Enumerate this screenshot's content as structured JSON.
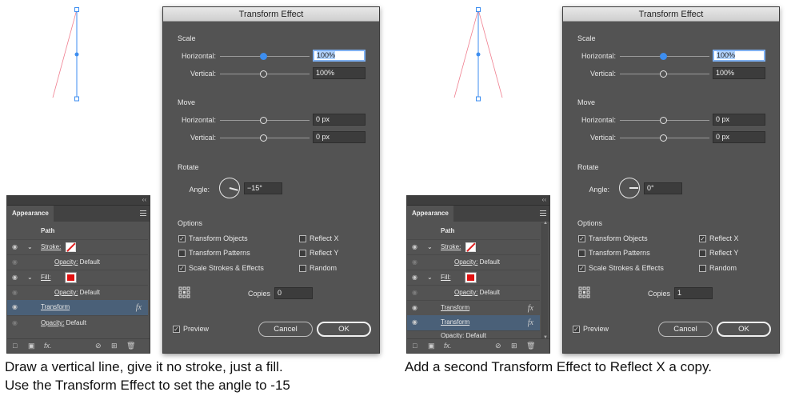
{
  "colors": {
    "accent": "#3d8ef0",
    "dialog_bg": "#535353",
    "fill_swatch": "#e01010",
    "selected_row": "#4a6078",
    "guide_line": "#f08090"
  },
  "steps": [
    {
      "dialog": {
        "title": "Transform Effect",
        "scale": {
          "label": "Scale",
          "h_label": "Horizontal:",
          "h_value": "100%",
          "v_label": "Vertical:",
          "v_value": "100%"
        },
        "move": {
          "label": "Move",
          "h_label": "Horizontal:",
          "h_value": "0 px",
          "v_label": "Vertical:",
          "v_value": "0 px"
        },
        "rotate": {
          "label": "Rotate",
          "angle_label": "Angle:",
          "angle_value": "−15°"
        },
        "options": {
          "label": "Options",
          "transform_objects": "Transform Objects",
          "transform_patterns": "Transform Patterns",
          "scale_strokes": "Scale Strokes & Effects",
          "reflect_x": "Reflect X",
          "reflect_y": "Reflect Y",
          "random": "Random",
          "copies_label": "Copies",
          "copies_value": "0"
        },
        "preview": "Preview",
        "cancel": "Cancel",
        "ok": "OK",
        "checked": {
          "transform_objects": true,
          "transform_patterns": false,
          "scale_strokes": true,
          "reflect_x": false,
          "reflect_y": false,
          "random": false,
          "preview": true
        }
      },
      "panel": {
        "tab": "Appearance",
        "path": "Path",
        "rows": [
          {
            "label": "Stroke:",
            "type": "stroke"
          },
          {
            "label": "Opacity:",
            "value": "Default",
            "type": "sub"
          },
          {
            "label": "Fill:",
            "type": "fill"
          },
          {
            "label": "Opacity:",
            "value": "Default",
            "type": "sub"
          },
          {
            "label": "Transform",
            "type": "effect",
            "selected": true
          },
          {
            "label": "Opacity:",
            "value": "Default",
            "type": "top"
          }
        ]
      },
      "caption_lines": [
        "Draw a vertical line, give it no stroke, just a fill.",
        "Use the Transform Effect to set the angle to -15"
      ]
    },
    {
      "dialog": {
        "title": "Transform Effect",
        "scale": {
          "label": "Scale",
          "h_label": "Horizontal:",
          "h_value": "100%",
          "v_label": "Vertical:",
          "v_value": "100%"
        },
        "move": {
          "label": "Move",
          "h_label": "Horizontal:",
          "h_value": "0 px",
          "v_label": "Vertical:",
          "v_value": "0 px"
        },
        "rotate": {
          "label": "Rotate",
          "angle_label": "Angle:",
          "angle_value": "0°"
        },
        "options": {
          "label": "Options",
          "transform_objects": "Transform Objects",
          "transform_patterns": "Transform Patterns",
          "scale_strokes": "Scale Strokes & Effects",
          "reflect_x": "Reflect X",
          "reflect_y": "Reflect Y",
          "random": "Random",
          "copies_label": "Copies",
          "copies_value": "1"
        },
        "preview": "Preview",
        "cancel": "Cancel",
        "ok": "OK",
        "checked": {
          "transform_objects": true,
          "transform_patterns": false,
          "scale_strokes": true,
          "reflect_x": true,
          "reflect_y": false,
          "random": false,
          "preview": true
        }
      },
      "panel": {
        "tab": "Appearance",
        "path": "Path",
        "rows": [
          {
            "label": "Stroke:",
            "type": "stroke"
          },
          {
            "label": "Opacity:",
            "value": "Default",
            "type": "sub"
          },
          {
            "label": "Fill:",
            "type": "fill"
          },
          {
            "label": "Opacity:",
            "value": "Default",
            "type": "sub"
          },
          {
            "label": "Transform",
            "type": "effect"
          },
          {
            "label": "Transform",
            "type": "effect",
            "selected": true
          },
          {
            "label": "Opacity:",
            "value": "Default",
            "type": "top"
          }
        ]
      },
      "caption_lines": [
        "Add a second Transform Effect to Reflect X a copy."
      ]
    }
  ]
}
